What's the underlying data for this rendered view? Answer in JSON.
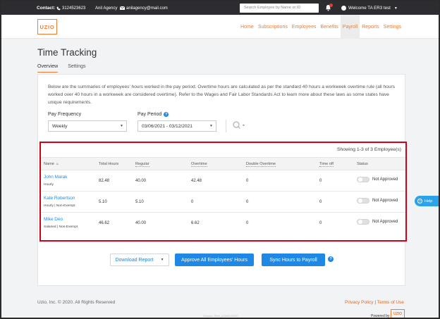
{
  "topbar": {
    "contact_label": "Contact:",
    "phone": "3124523623",
    "agency": "Anil Agency",
    "email": "anilagency@mail.com",
    "search_placeholder": "Search Employee by Name or ID",
    "notification_count": "2",
    "welcome": "Welcome TA ER3 test"
  },
  "brand": {
    "logo_text": "UZIO",
    "accent": "#f07c32",
    "primary": "#1f88e5"
  },
  "nav": [
    "Home",
    "Subscriptions",
    "Employees",
    "Benefits",
    "Payroll",
    "Reports",
    "Settings"
  ],
  "page": {
    "title": "Time Tracking",
    "tabs": [
      "Overview",
      "Settings"
    ],
    "description": "Below are the summaries of employees' hours worked in the pay period. Overtime hours are calculated as per the standard 40 hours a workweek overtime rule (all hours worked over 40 hours in a workweek are considered overtime). Refer to the Wages and Fair Labor Standards Act to learn more about these laws as some states have unique requirements."
  },
  "filters": {
    "pay_frequency_label": "Pay Frequency",
    "pay_frequency_value": "Weekly",
    "pay_period_label": "Pay Period",
    "pay_period_value": "03/06/2021 - 03/12/2021"
  },
  "table": {
    "showing": "Showing 1-3 of 3 Employee(s)",
    "headers": [
      "Name",
      "Total Hours",
      "Regular",
      "Overtime",
      "Double Overtime",
      "Time off",
      "Status"
    ],
    "rows": [
      {
        "name": "John Marak",
        "type": "Hourly",
        "total": "82.48",
        "regular": "40.00",
        "overtime": "42.48",
        "double": "0",
        "timeoff": "0",
        "status": "Not Approved"
      },
      {
        "name": "Kate Robertson",
        "type": "Hourly | Non-Exempt",
        "total": "5.10",
        "regular": "5.10",
        "overtime": "0",
        "double": "0",
        "timeoff": "0",
        "status": "Not Approved"
      },
      {
        "name": "Mike Deo",
        "type": "Salaried | Non-Exempt",
        "total": "46.62",
        "regular": "40.00",
        "overtime": "6.62",
        "double": "0",
        "timeoff": "0",
        "status": "Not Approved"
      }
    ]
  },
  "actions": {
    "download": "Download Report",
    "approve": "Approve All Employees' Hours",
    "sync": "Sync Hours to Payroll"
  },
  "help": {
    "label": "Help"
  },
  "footer": {
    "copyright": "Uzio, Inc. © 2020. All Rights Reserved",
    "privacy": "Privacy Policy",
    "terms": "Terms of Use",
    "version": "Version: PHH_4/24/01/2020",
    "powered": "Powered by"
  }
}
